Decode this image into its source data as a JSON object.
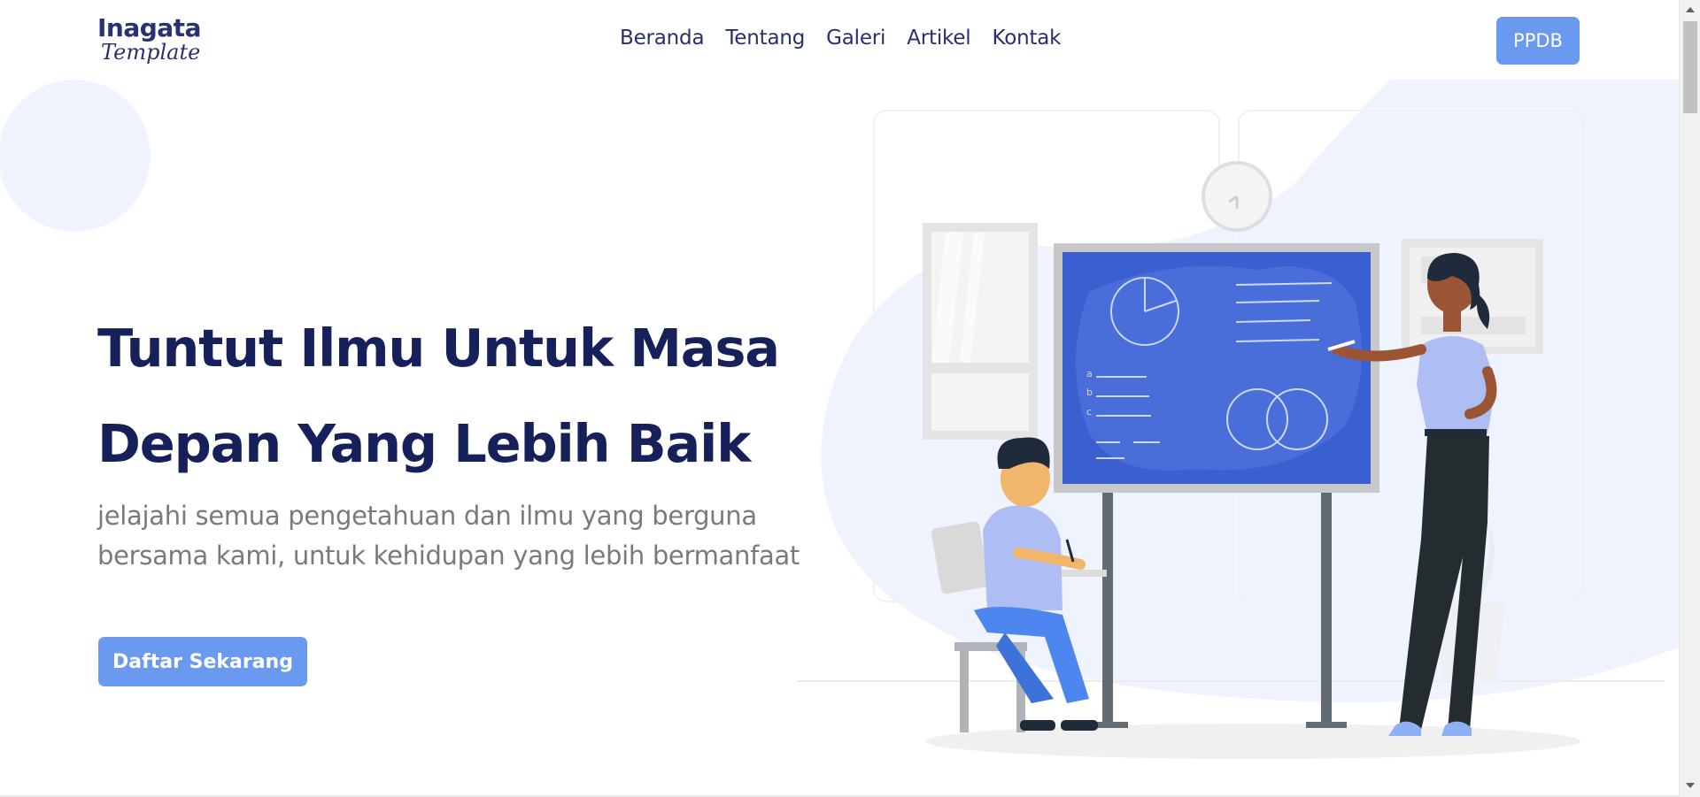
{
  "brand": {
    "name": "Inagata",
    "subtitle": "Template"
  },
  "nav": {
    "items": [
      {
        "label": "Beranda"
      },
      {
        "label": "Tentang"
      },
      {
        "label": "Galeri"
      },
      {
        "label": "Artikel"
      },
      {
        "label": "Kontak"
      }
    ],
    "cta_label": "PPDB"
  },
  "hero": {
    "title_line1": "Tuntut Ilmu Untuk Masa",
    "title_line2": "Depan Yang Lebih Baik",
    "subtitle": "jelajahi semua pengetahuan dan ilmu yang berguna bersama kami, untuk kehidupan yang lebih bermanfaat",
    "cta_label": "Daftar Sekarang"
  },
  "colors": {
    "accent": "#6a9af0",
    "heading": "#16205a",
    "body_text": "#7a7a7a",
    "board": "#3a5fd1"
  }
}
